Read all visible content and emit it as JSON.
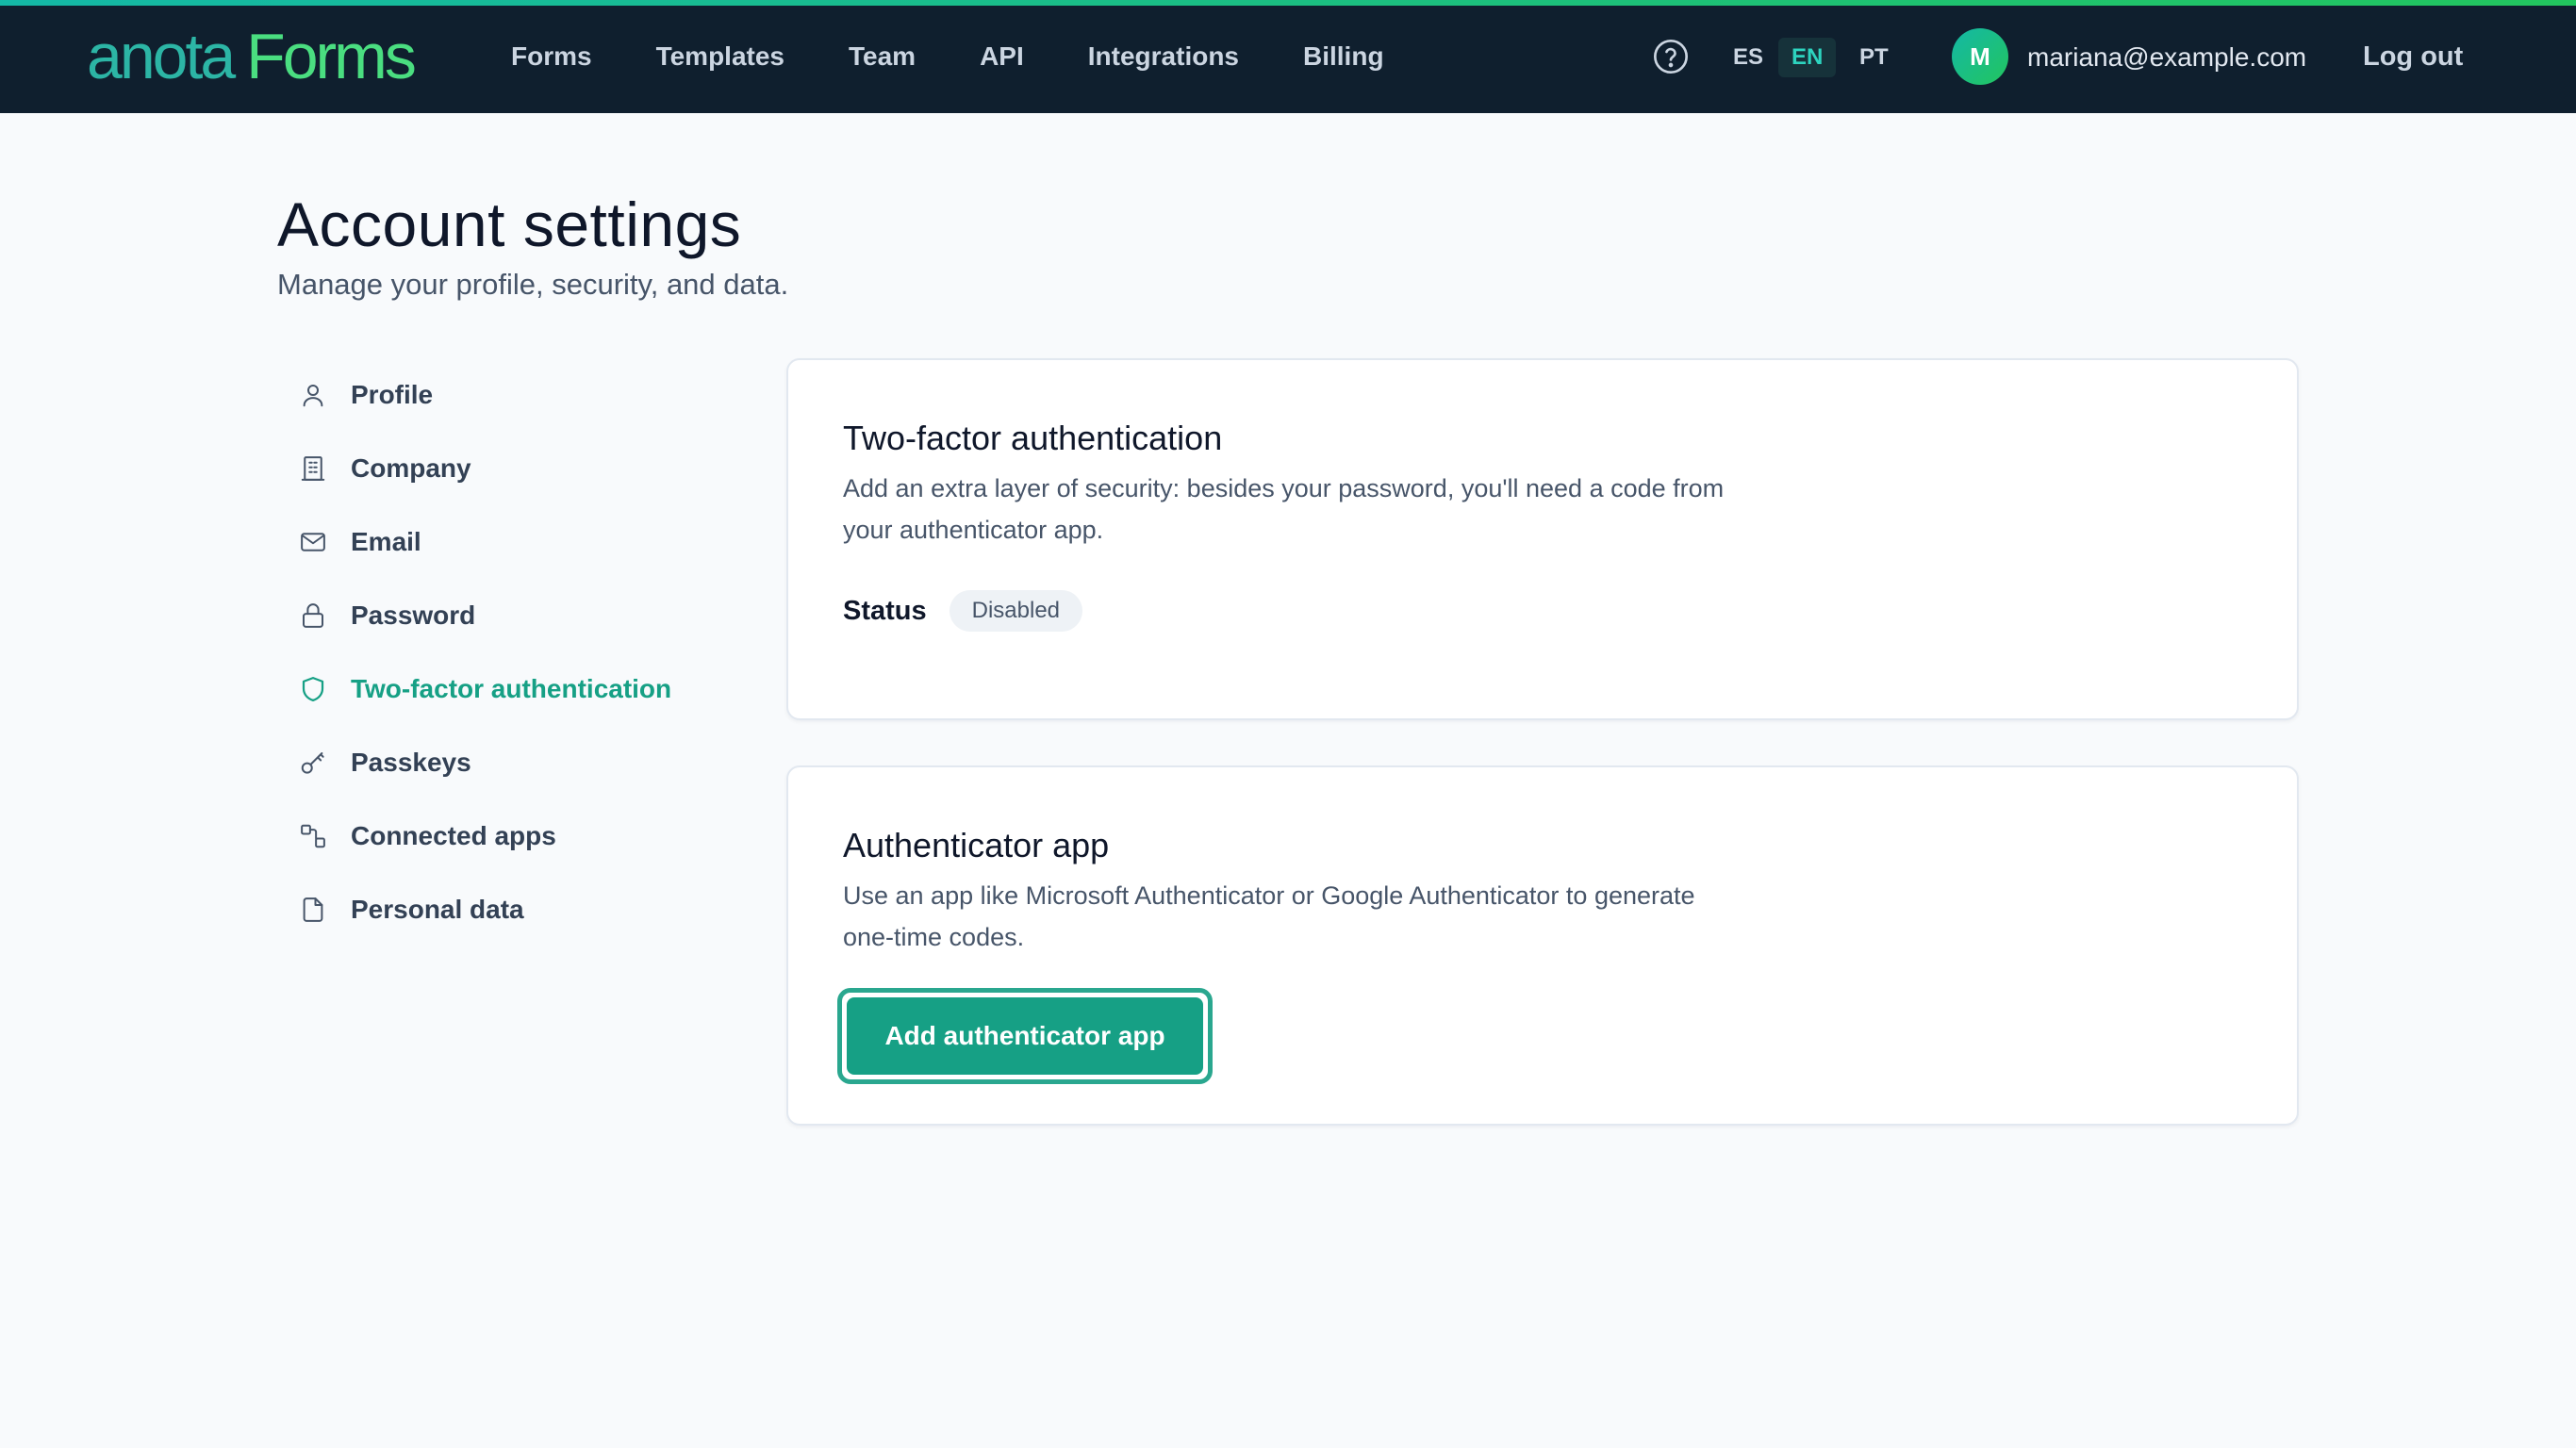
{
  "brand": {
    "word1": "anota",
    "word2": "Forms",
    "accent_color": "#16a085"
  },
  "nav": {
    "items": [
      "Forms",
      "Templates",
      "Team",
      "API",
      "Integrations",
      "Billing"
    ]
  },
  "header_tools": {
    "help_icon": "question-circle-icon",
    "languages": [
      "ES",
      "EN",
      "PT"
    ],
    "active_language": "EN",
    "avatar_initial": "M",
    "user_email": "mariana@example.com",
    "logout_label": "Log out"
  },
  "page": {
    "title": "Account settings",
    "subtitle": "Manage your profile, security, and data."
  },
  "sidebar": {
    "active": "Two-factor authentication",
    "items": [
      {
        "label": "Profile",
        "icon": "user-icon"
      },
      {
        "label": "Company",
        "icon": "building-icon"
      },
      {
        "label": "Email",
        "icon": "mail-icon"
      },
      {
        "label": "Password",
        "icon": "lock-icon"
      },
      {
        "label": "Two-factor authentication",
        "icon": "shield-icon"
      },
      {
        "label": "Passkeys",
        "icon": "key-icon"
      },
      {
        "label": "Connected apps",
        "icon": "connected-apps-icon"
      },
      {
        "label": "Personal data",
        "icon": "file-icon"
      }
    ]
  },
  "two_factor_card": {
    "title": "Two-factor authentication",
    "description": "Add an extra layer of security: besides your password, you'll need a code from your authenticator app.",
    "status_label": "Status",
    "status_value": "Disabled"
  },
  "authenticator_card": {
    "title": "Authenticator app",
    "description": "Use an app like Microsoft Authenticator or Google Authenticator to generate one-time codes.",
    "button_label": "Add authenticator app"
  }
}
